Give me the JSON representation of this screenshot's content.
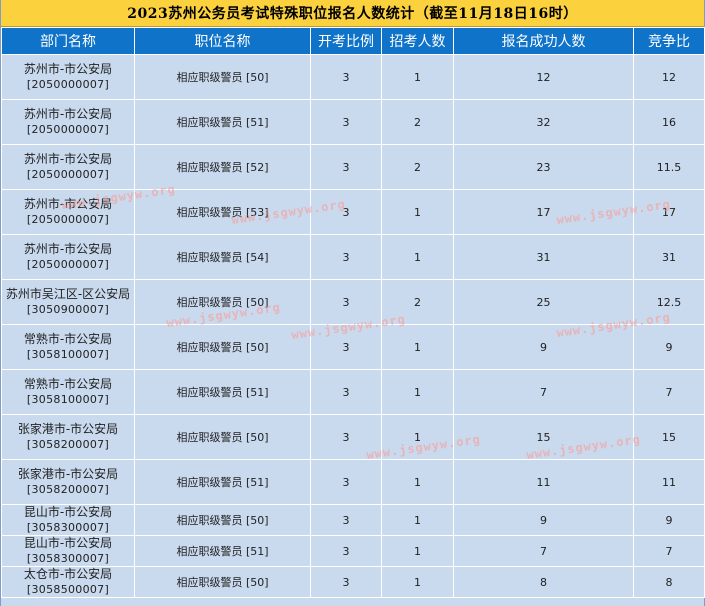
{
  "title": "2023苏州公务员考试特殊职位报名人数统计（截至11月18日16时）",
  "headers": [
    "部门名称",
    "职位名称",
    "开考比例",
    "招考人数",
    "报名成功人数",
    "竞争比"
  ],
  "rows": [
    {
      "dept": "苏州市-市公安局",
      "code": "[2050000007]",
      "position": "相应职级警员 [50]",
      "ratio": "3",
      "recruit": "1",
      "applicants": "12",
      "competition": "12"
    },
    {
      "dept": "苏州市-市公安局",
      "code": "[2050000007]",
      "position": "相应职级警员 [51]",
      "ratio": "3",
      "recruit": "2",
      "applicants": "32",
      "competition": "16"
    },
    {
      "dept": "苏州市-市公安局",
      "code": "[2050000007]",
      "position": "相应职级警员 [52]",
      "ratio": "3",
      "recruit": "2",
      "applicants": "23",
      "competition": "11.5"
    },
    {
      "dept": "苏州市-市公安局",
      "code": "[2050000007]",
      "position": "相应职级警员 [53]",
      "ratio": "3",
      "recruit": "1",
      "applicants": "17",
      "competition": "17"
    },
    {
      "dept": "苏州市-市公安局",
      "code": "[2050000007]",
      "position": "相应职级警员 [54]",
      "ratio": "3",
      "recruit": "1",
      "applicants": "31",
      "competition": "31"
    },
    {
      "dept": "苏州市吴江区-区公安局",
      "code": "[3050900007]",
      "position": "相应职级警员 [50]",
      "ratio": "3",
      "recruit": "2",
      "applicants": "25",
      "competition": "12.5"
    },
    {
      "dept": "常熟市-市公安局",
      "code": "[3058100007]",
      "position": "相应职级警员 [50]",
      "ratio": "3",
      "recruit": "1",
      "applicants": "9",
      "competition": "9"
    },
    {
      "dept": "常熟市-市公安局",
      "code": "[3058100007]",
      "position": "相应职级警员 [51]",
      "ratio": "3",
      "recruit": "1",
      "applicants": "7",
      "competition": "7"
    },
    {
      "dept": "张家港市-市公安局",
      "code": "[3058200007]",
      "position": "相应职级警员 [50]",
      "ratio": "3",
      "recruit": "1",
      "applicants": "15",
      "competition": "15"
    },
    {
      "dept": "张家港市-市公安局",
      "code": "[3058200007]",
      "position": "相应职级警员 [51]",
      "ratio": "3",
      "recruit": "1",
      "applicants": "11",
      "competition": "11"
    },
    {
      "dept": "昆山市-市公安局",
      "code": "[3058300007]",
      "position": "相应职级警员 [50]",
      "ratio": "3",
      "recruit": "1",
      "applicants": "9",
      "competition": "9"
    },
    {
      "dept": "昆山市-市公安局",
      "code": "[3058300007]",
      "position": "相应职级警员 [51]",
      "ratio": "3",
      "recruit": "1",
      "applicants": "7",
      "competition": "7"
    },
    {
      "dept": "太仓市-市公安局",
      "code": "[3058500007]",
      "position": "相应职级警员 [50]",
      "ratio": "3",
      "recruit": "1",
      "applicants": "8",
      "competition": "8"
    }
  ],
  "watermark": "www.jsgwyw.org"
}
